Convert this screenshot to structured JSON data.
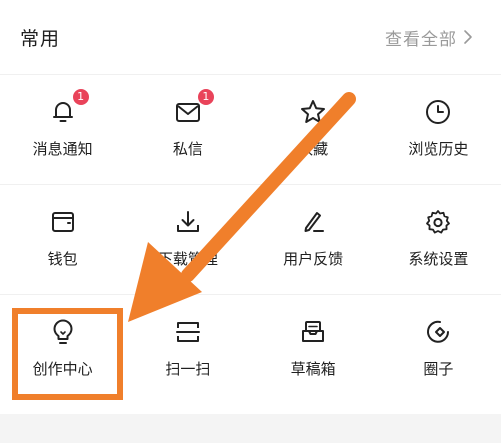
{
  "header": {
    "title": "常用",
    "view_all": "查看全部"
  },
  "items": [
    {
      "label": "消息通知",
      "icon": "bell-icon",
      "badge": "1"
    },
    {
      "label": "私信",
      "icon": "mail-icon",
      "badge": "1"
    },
    {
      "label": "收藏",
      "icon": "star-icon",
      "badge": null
    },
    {
      "label": "浏览历史",
      "icon": "clock-icon",
      "badge": null
    },
    {
      "label": "钱包",
      "icon": "wallet-icon",
      "badge": null
    },
    {
      "label": "下载管理",
      "icon": "download-icon",
      "badge": null
    },
    {
      "label": "用户反馈",
      "icon": "pencil-icon",
      "badge": null
    },
    {
      "label": "系统设置",
      "icon": "gear-icon",
      "badge": null
    },
    {
      "label": "创作中心",
      "icon": "lightbulb-icon",
      "badge": null
    },
    {
      "label": "扫一扫",
      "icon": "scan-icon",
      "badge": null
    },
    {
      "label": "草稿箱",
      "icon": "draft-box-icon",
      "badge": null
    },
    {
      "label": "圈子",
      "icon": "circle-group-icon",
      "badge": null
    }
  ],
  "colors": {
    "badge": "#e9435a",
    "highlight": "#f07f2b",
    "icon_stroke": "#222222",
    "muted_text": "#9a9a9a"
  }
}
